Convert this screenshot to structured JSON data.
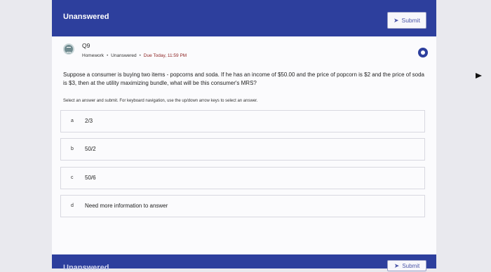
{
  "header": {
    "title": "Unanswered",
    "submit_label": "Submit"
  },
  "question": {
    "number": "Q9",
    "category": "Homework",
    "status": "Unanswered",
    "due": "Due Today, 11:59 PM",
    "text": "Suppose a consumer is buying two items - popcorns and soda. If he has an income of $50.00 and the price of popcorn is $2 and the price of soda is $3, then at the utility maximizing bundle, what will be this consumer's MRS?",
    "instructions": "Select an answer and submit. For keyboard navigation, use the up/down arrow keys to select an answer."
  },
  "options": [
    {
      "letter": "a",
      "text": "2/3"
    },
    {
      "letter": "b",
      "text": "50/2"
    },
    {
      "letter": "c",
      "text": "50/6"
    },
    {
      "letter": "d",
      "text": "Need more information to answer"
    }
  ],
  "footer": {
    "title": "Unanswered",
    "submit_label": "Submit"
  },
  "colors": {
    "header_bg": "#2d3f9d",
    "due_text": "#8b1f1f"
  }
}
